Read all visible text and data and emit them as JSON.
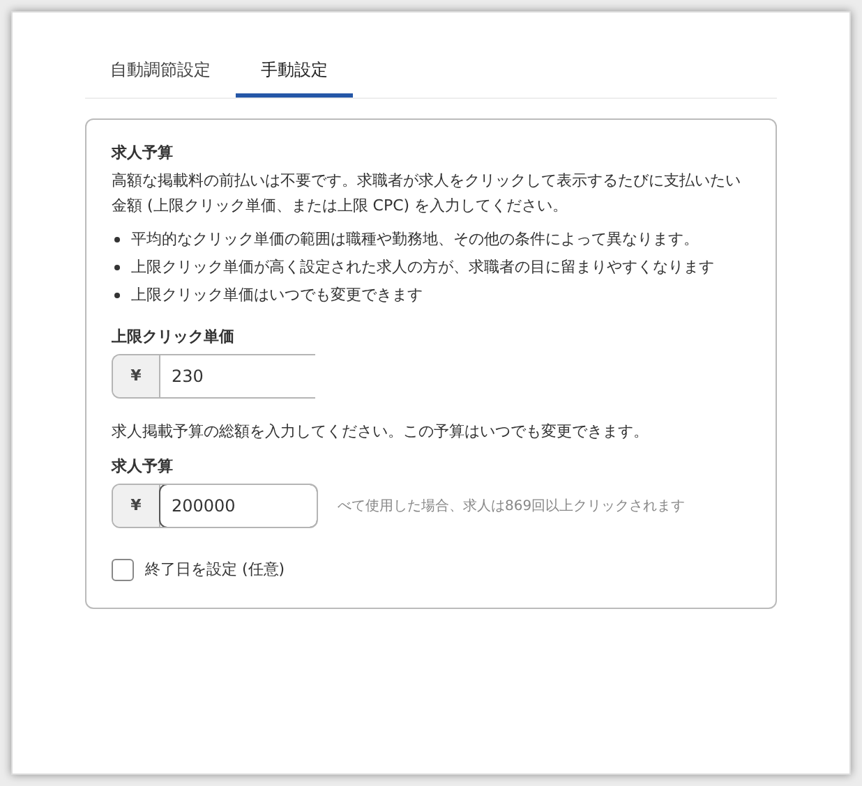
{
  "tabs": [
    {
      "label": "自動調節設定",
      "selected": false
    },
    {
      "label": "手動設定",
      "selected": true
    }
  ],
  "budget_section": {
    "title": "求人予算",
    "description": "高額な掲載料の前払いは不要です。求職者が求人をクリックして表示するたびに支払いたい金額 (上限クリック単価、または上限 CPC) を入力してください。",
    "bullets": [
      "平均的なクリック単価の範囲は職種や勤務地、その他の条件によって異なります。",
      "上限クリック単価が高く設定された求人の方が、求職者の目に留まりやすくなります",
      "上限クリック単価はいつでも変更できます"
    ]
  },
  "max_cpc": {
    "label": "上限クリック単価",
    "currency": "¥",
    "value": "230"
  },
  "budget_note": "求人掲載予算の総額を入力してください。この予算はいつでも変更できます。",
  "budget": {
    "label": "求人予算",
    "currency": "¥",
    "value": "200000",
    "hint": "べて使用した場合、求人は869回以上クリックされます"
  },
  "end_date": {
    "label": "終了日を設定 (任意)",
    "checked": false
  }
}
